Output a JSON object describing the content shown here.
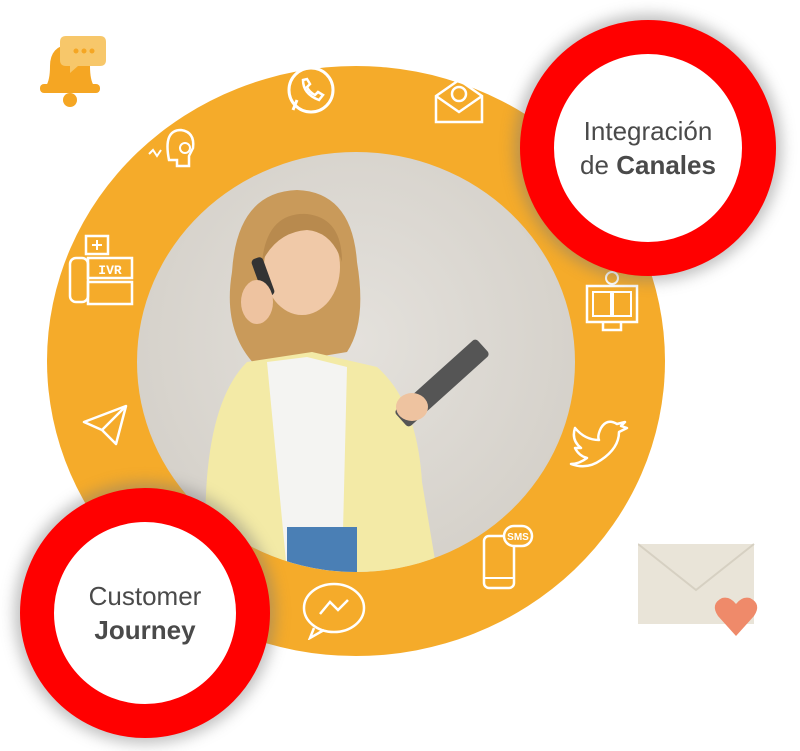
{
  "badges": {
    "integration": {
      "line1": "Integración",
      "line2_prefix": "de",
      "line2_bold": "Canales"
    },
    "journey": {
      "line1": "Customer",
      "line2_bold": "Journey"
    }
  },
  "icons": {
    "ivr_label": "IVR",
    "sms_label": "SMS"
  },
  "colors": {
    "ring": "#f5ab2a",
    "badge_border": "#ff0000",
    "badge_text": "#4a4a4a",
    "heart": "#ef8a6a",
    "envelope": "#e9e4d8"
  }
}
